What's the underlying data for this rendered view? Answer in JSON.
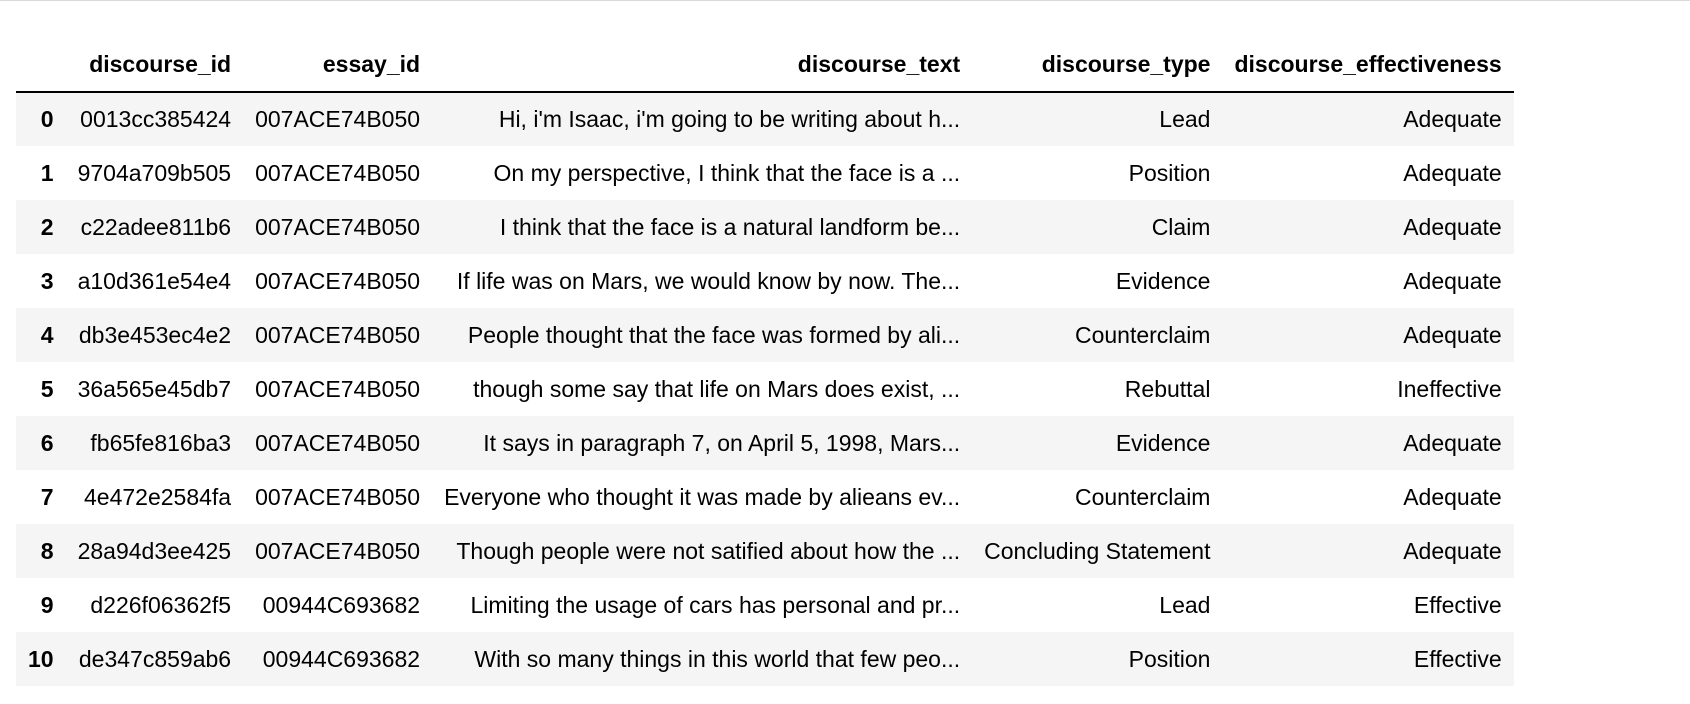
{
  "table": {
    "columns": [
      "",
      "discourse_id",
      "essay_id",
      "discourse_text",
      "discourse_type",
      "discourse_effectiveness"
    ],
    "rows": [
      {
        "index": "0",
        "discourse_id": "0013cc385424",
        "essay_id": "007ACE74B050",
        "discourse_text": "Hi, i'm Isaac, i'm going to be writing about h...",
        "discourse_type": "Lead",
        "discourse_effectiveness": "Adequate"
      },
      {
        "index": "1",
        "discourse_id": "9704a709b505",
        "essay_id": "007ACE74B050",
        "discourse_text": "On my perspective, I think that the face is a ...",
        "discourse_type": "Position",
        "discourse_effectiveness": "Adequate"
      },
      {
        "index": "2",
        "discourse_id": "c22adee811b6",
        "essay_id": "007ACE74B050",
        "discourse_text": "I think that the face is a natural landform be...",
        "discourse_type": "Claim",
        "discourse_effectiveness": "Adequate"
      },
      {
        "index": "3",
        "discourse_id": "a10d361e54e4",
        "essay_id": "007ACE74B050",
        "discourse_text": "If life was on Mars, we would know by now. The...",
        "discourse_type": "Evidence",
        "discourse_effectiveness": "Adequate"
      },
      {
        "index": "4",
        "discourse_id": "db3e453ec4e2",
        "essay_id": "007ACE74B050",
        "discourse_text": "People thought that the face was formed by ali...",
        "discourse_type": "Counterclaim",
        "discourse_effectiveness": "Adequate"
      },
      {
        "index": "5",
        "discourse_id": "36a565e45db7",
        "essay_id": "007ACE74B050",
        "discourse_text": "though some say that life on Mars does exist, ...",
        "discourse_type": "Rebuttal",
        "discourse_effectiveness": "Ineffective"
      },
      {
        "index": "6",
        "discourse_id": "fb65fe816ba3",
        "essay_id": "007ACE74B050",
        "discourse_text": "It says in paragraph 7, on April 5, 1998, Mars...",
        "discourse_type": "Evidence",
        "discourse_effectiveness": "Adequate"
      },
      {
        "index": "7",
        "discourse_id": "4e472e2584fa",
        "essay_id": "007ACE74B050",
        "discourse_text": "Everyone who thought it was made by alieans ev...",
        "discourse_type": "Counterclaim",
        "discourse_effectiveness": "Adequate"
      },
      {
        "index": "8",
        "discourse_id": "28a94d3ee425",
        "essay_id": "007ACE74B050",
        "discourse_text": "Though people were not satified about how the ...",
        "discourse_type": "Concluding Statement",
        "discourse_effectiveness": "Adequate"
      },
      {
        "index": "9",
        "discourse_id": "d226f06362f5",
        "essay_id": "00944C693682",
        "discourse_text": "Limiting the usage of cars has personal and pr...",
        "discourse_type": "Lead",
        "discourse_effectiveness": "Effective"
      },
      {
        "index": "10",
        "discourse_id": "de347c859ab6",
        "essay_id": "00944C693682",
        "discourse_text": "With so many things in this world that few peo...",
        "discourse_type": "Position",
        "discourse_effectiveness": "Effective"
      }
    ]
  },
  "colors": {
    "stripe": "#f5f5f5",
    "header_rule": "#000000",
    "top_rule": "#d9d9d9"
  }
}
